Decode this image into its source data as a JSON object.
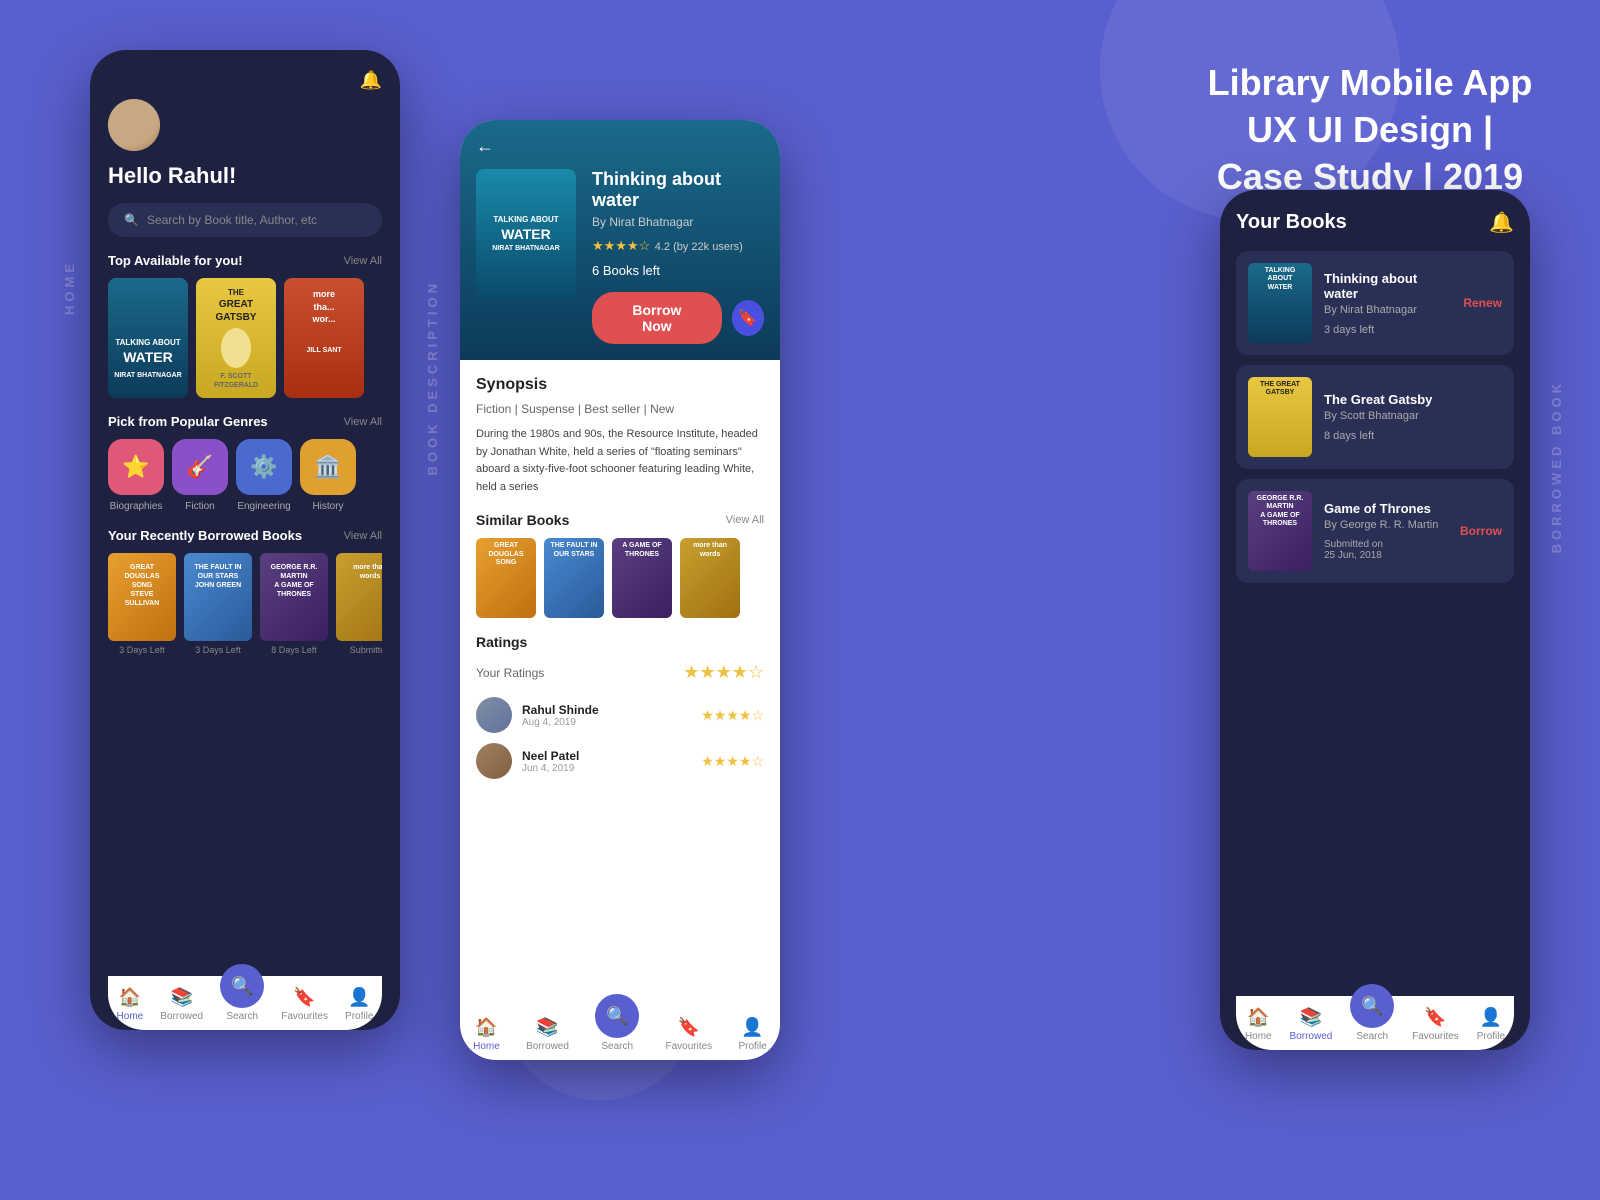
{
  "background": {
    "color": "#5a5fcf"
  },
  "title": {
    "line1": "Library Mobile App",
    "line2": "UX UI Design |",
    "line3": "Case Study | 2019"
  },
  "phone1": {
    "label": "HOME",
    "greeting": "Hello Rahul!",
    "search_placeholder": "Search by Book title, Author, etc",
    "top_section": "Top Available for you!",
    "view_all": "View All",
    "book1_title": "TALKING ABOUT WATER",
    "book1_author": "NIRAT BHATNAGAR",
    "book2_title": "THE GREAT GATSBY",
    "book2_author": "F. SCOTT FITZGERALD",
    "book3_title": "more than words",
    "book3_author": "JILL SANT",
    "genres_section": "Pick from Popular Genres",
    "genres": [
      {
        "name": "Biographies",
        "icon": "⭐"
      },
      {
        "name": "Fiction",
        "icon": "🎸"
      },
      {
        "name": "Engineering",
        "icon": "⚙️"
      },
      {
        "name": "History",
        "icon": "🏛️"
      }
    ],
    "recent_section": "Your Recently Borrowed Books",
    "recent_books": [
      {
        "label": "3 Days Left"
      },
      {
        "label": "3 Days Left"
      },
      {
        "label": "8 Days Left"
      },
      {
        "label": "Submitted"
      }
    ],
    "nav": [
      {
        "label": "Home",
        "active": true
      },
      {
        "label": "Borrowed",
        "active": false
      },
      {
        "label": "Search",
        "active": false
      },
      {
        "label": "Favourites",
        "active": false
      },
      {
        "label": "Profile",
        "active": false
      }
    ]
  },
  "phone2": {
    "label": "BOOK DESCRIPTION",
    "book_title": "Thinking about water",
    "book_author": "By Nirat Bhatnagar",
    "rating": "4.2",
    "rating_count": "(by 22k users)",
    "books_left": "6 Books left",
    "borrow_btn": "Borrow Now",
    "synopsis_title": "Synopsis",
    "tags": "Fiction  |  Suspense  |  Best seller  |  New",
    "synopsis_text": "During the 1980s and 90s, the Resource Institute, headed by Jonathan White, held a series of \"floating seminars\" aboard a sixty-five-foot schooner featuring leading White, held a series",
    "similar_title": "Similar Books",
    "similar_view_all": "View All",
    "ratings_title": "Ratings",
    "your_ratings_label": "Your Ratings",
    "reviews": [
      {
        "name": "Rahul Shinde",
        "date": "Aug 4, 2019"
      },
      {
        "name": "Neel Patel",
        "date": "Jun 4, 2019"
      }
    ],
    "nav": [
      {
        "label": "Home",
        "active": true
      },
      {
        "label": "Borrowed",
        "active": false
      },
      {
        "label": "Search",
        "active": false
      },
      {
        "label": "Favourites",
        "active": false
      },
      {
        "label": "Profile",
        "active": false
      }
    ]
  },
  "phone3": {
    "label": "BORROWED BOOK",
    "title": "Your Books",
    "books": [
      {
        "title": "Thinking about water",
        "author": "By Nirat Bhatnagar",
        "status": "3 days left",
        "action": "Renew",
        "cover_class": "cover-water"
      },
      {
        "title": "The Great Gatsby",
        "author": "By Scott Bhatnagar",
        "status": "8 days left",
        "action": "",
        "cover_class": "cover-gatsby"
      },
      {
        "title": "Game of Thrones",
        "author": "By George R. R. Martin",
        "status": "Submitted on\n25 Jun, 2018",
        "action": "Borrow",
        "cover_class": "cover-thrones"
      }
    ],
    "nav": [
      {
        "label": "Home",
        "active": false
      },
      {
        "label": "Borrowed",
        "active": true
      },
      {
        "label": "Search",
        "active": false
      },
      {
        "label": "Favourites",
        "active": false
      },
      {
        "label": "Profile",
        "active": false
      }
    ]
  }
}
